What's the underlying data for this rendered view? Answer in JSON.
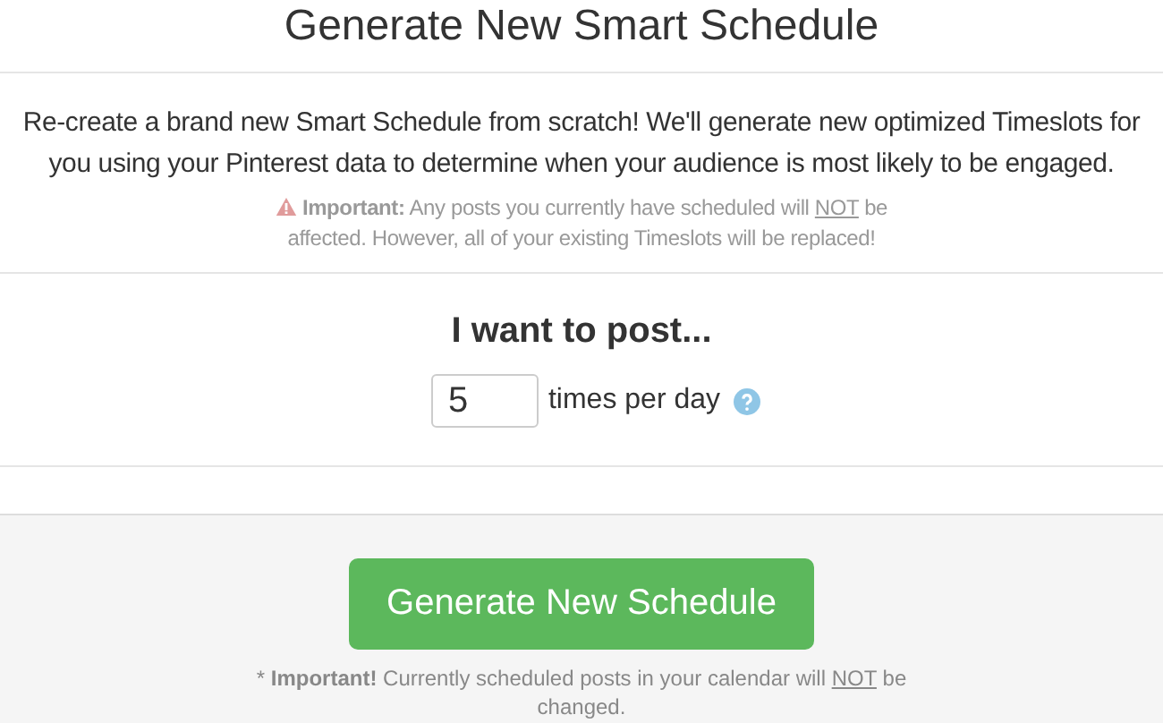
{
  "title": "Generate New Smart Schedule",
  "description": "Re-create a brand new Smart Schedule from scratch! We'll generate new optimized Timeslots for you using your Pinterest data to determine when your audience is most likely to be engaged.",
  "warning": [
    {
      "text": "Important:",
      "kind": "bold"
    },
    {
      "text": " Any posts you currently have scheduled will ",
      "kind": "plain"
    },
    {
      "text": "NOT",
      "kind": "underline"
    },
    {
      "text": " be affected. However, all of your existing Timeslots will be replaced!",
      "kind": "plain"
    }
  ],
  "form": {
    "heading": "I want to post...",
    "value": "5",
    "unit": "times per day"
  },
  "button": "Generate New Schedule",
  "footnote": [
    {
      "text": "* ",
      "kind": "plain"
    },
    {
      "text": "Important!",
      "kind": "bold"
    },
    {
      "text": " Currently scheduled posts in your calendar will ",
      "kind": "plain"
    },
    {
      "text": "NOT",
      "kind": "underline"
    },
    {
      "text": " be changed.",
      "kind": "plain"
    }
  ]
}
